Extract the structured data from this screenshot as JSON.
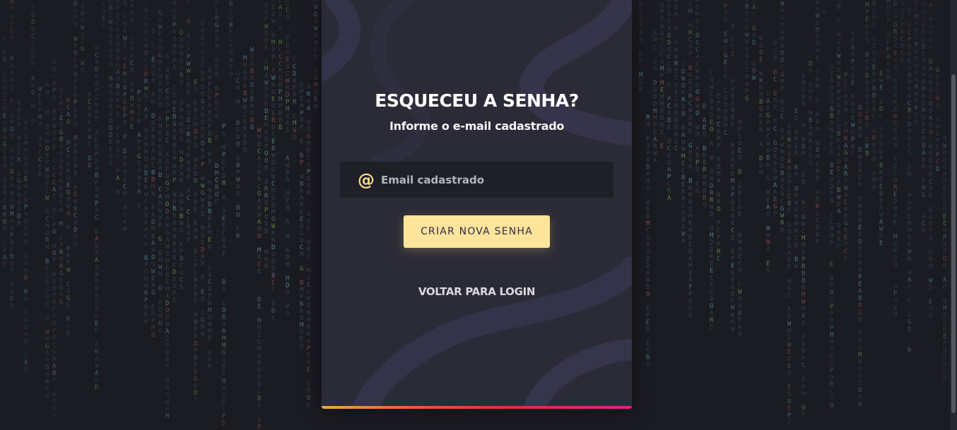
{
  "card": {
    "title": "ESQUECEU A SENHA?",
    "subtitle": "Informe o e-mail cadastrado",
    "email_field": {
      "placeholder": "Email cadastrado",
      "value": "",
      "icon": "at-icon",
      "icon_glyph": "@"
    },
    "submit_button_label": "CRIAR NOVA SENHA",
    "back_link_label": "VOLTAR PARA LOGIN"
  },
  "colors": {
    "page_background": "#1b1c22",
    "card_background": "#2b2b37",
    "input_background": "#1f1f27",
    "button_background": "#ffe49b",
    "button_text": "#2c2c44",
    "accent_icon": "#f3d98c",
    "bottom_bar_gradient": [
      "#f3a93a",
      "#ef5a2a",
      "#e02f3c",
      "#e0218f"
    ]
  }
}
